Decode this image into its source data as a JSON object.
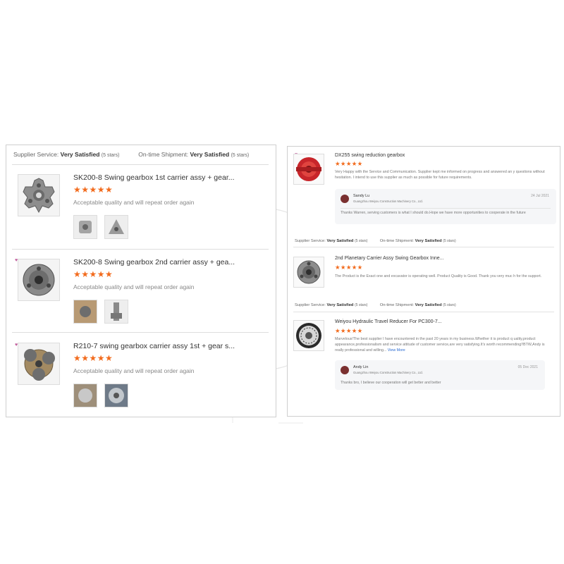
{
  "left": {
    "service": {
      "supplier_label": "Supplier Service:",
      "supplier_value": "Very Satisfied",
      "supplier_stars": "(5 stars)",
      "shipment_label": "On-time Shipment:",
      "shipment_value": "Very Satisfied",
      "shipment_stars": "(5 stars)"
    },
    "reviews": [
      {
        "title": "SK200-8 Swing gearbox 1st carrier assy + gear...",
        "stars": "★★★★★",
        "rating": 5,
        "comment": "Acceptable quality and will repeat order again"
      },
      {
        "title": "SK200-8 Swing gearbox 2nd carrier assy + gea...",
        "stars": "★★★★★",
        "rating": 5,
        "comment": "Acceptable quality and will repeat order again"
      },
      {
        "title": "R210-7 swing gearbox carrier assy 1st + gear s...",
        "stars": "★★★★★",
        "rating": 5,
        "comment": "Acceptable quality and will repeat order again"
      }
    ]
  },
  "right": {
    "reviews": [
      {
        "title": "DX255 swing reduction gearbox",
        "stars": "★★★★★",
        "rating": 5,
        "text": "Very Happy with the Service and Communication. Supplier kept me informed on progress and answered an y questions without hesitation. I intend to use this supplier as much as possible for future requirements.",
        "reply": {
          "name": "Sandy Lu",
          "company": "Guangzhou Weiyou Construction Machinery Co., Ltd.",
          "date": "24 Jul 2021",
          "message": "Thanks Warren, serving customers is what I should do.Hope we have more opportunities to cooperate in the future"
        }
      },
      {
        "title": "2nd Planetary Carrier Assy Swing Gearbox Inne...",
        "stars": "★★★★★",
        "rating": 5,
        "text": "The Product is the Exact one and excavator is operating well. Product Quality is Good. Thank you very muc h for the support."
      },
      {
        "title": "Weiyou Hydraulic Travel Reducer For PC300-7...",
        "stars": "★★★★★",
        "rating": 5,
        "text": "Marvelous!The best supplier I have encountered in the past 20 years in my business.Whether it is product q uality,product appearance,professionalism and service attitude of customer service,are very satisfying.It's worth recommending!!BTW,Andy is really professional and willing...",
        "view_more": "View More",
        "reply": {
          "name": "Andy Lin",
          "company": "Guangzhou Weiyou Construction Machinery Co., Ltd.",
          "date": "05 Dec 2021",
          "message": "Thanks bro, I believe our cooperation will get better and better"
        }
      }
    ],
    "service_rows": [
      {
        "supplier_label": "Supplier Service:",
        "supplier_value": "Very Satisfied",
        "supplier_stars": "(5 stars)",
        "shipment_label": "On-time Shipment:",
        "shipment_value": "Very Satisfied",
        "shipment_stars": "(5 stars)"
      },
      {
        "supplier_label": "Supplier Service:",
        "supplier_value": "Very Satisfied",
        "supplier_stars": "(5 stars)",
        "shipment_label": "On-time Shipment:",
        "shipment_value": "Very Satisfied",
        "shipment_stars": "(5 stars)"
      }
    ]
  },
  "colors": {
    "star": "#f26b1d",
    "link": "#2a6bd1",
    "border": "#cfcfcf",
    "gear_red": "#c8262b"
  }
}
